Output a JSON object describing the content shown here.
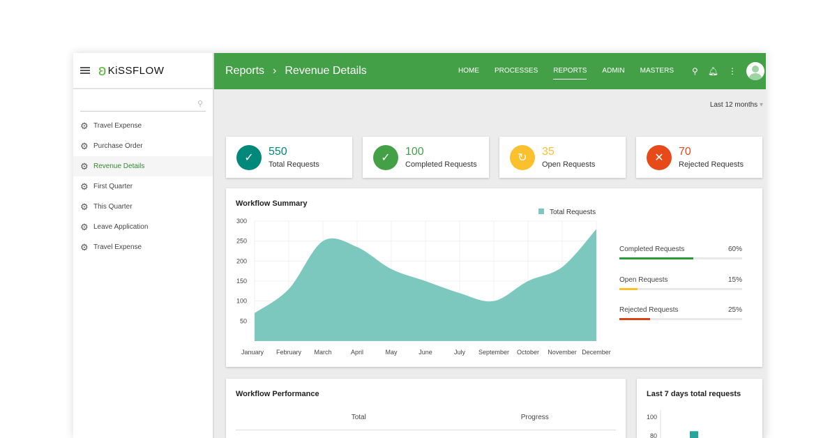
{
  "sidebar": {
    "brand": "KiSSFLOW",
    "items": [
      {
        "label": "Travel Expense"
      },
      {
        "label": "Purchase Order"
      },
      {
        "label": "Revenue Details",
        "active": true
      },
      {
        "label": "First Quarter"
      },
      {
        "label": "This Quarter"
      },
      {
        "label": "Leave Application"
      },
      {
        "label": "Travel Expense"
      }
    ]
  },
  "header": {
    "crumb1": "Reports",
    "sep": "›",
    "crumb2": "Revenue Details",
    "menu": [
      "HOME",
      "PROCESSES",
      "REPORTS",
      "ADMIN",
      "MASTERS"
    ],
    "active_menu": "REPORTS",
    "color": "#43a047"
  },
  "filter": {
    "range": "Last 12 months"
  },
  "stats": [
    {
      "value": "550",
      "label": "Total Requests",
      "color": "#00897b"
    },
    {
      "value": "100",
      "label": "Completed Requests",
      "color": "#43a047"
    },
    {
      "value": "35",
      "label": "Open Requests",
      "color": "#fbc02d"
    },
    {
      "value": "70",
      "label": "Rejected Requests",
      "color": "#e64a19"
    }
  ],
  "summary": {
    "title": "Workflow Summary",
    "progress": [
      {
        "label": "Completed Requests",
        "pct": "60%",
        "value": 60,
        "color": "#2e9a3a"
      },
      {
        "label": "Open Requests",
        "pct": "15%",
        "value": 15,
        "color": "#fbc02d"
      },
      {
        "label": "Rejected Requests",
        "pct": "25%",
        "value": 25,
        "color": "#d84315"
      }
    ]
  },
  "performance": {
    "title": "Workflow Performance",
    "cols": [
      "Total",
      "Progress"
    ]
  },
  "chart_data": [
    {
      "type": "area",
      "title": "Workflow Summary",
      "legend": "top-right",
      "series": [
        {
          "name": "Total Requests",
          "color": "#7cc8bf",
          "values": [
            70,
            130,
            250,
            235,
            180,
            150,
            120,
            100,
            150,
            185,
            280
          ]
        }
      ],
      "categories": [
        "January",
        "February",
        "March",
        "April",
        "May",
        "June",
        "July",
        "September",
        "October",
        "November",
        "December"
      ],
      "yticks": [
        50,
        100,
        150,
        200,
        250,
        300
      ],
      "ylim": [
        0,
        300
      ],
      "grid": true
    },
    {
      "type": "bar",
      "title": "Last 7 days total requests",
      "yticks": [
        80,
        100
      ],
      "values": [
        85
      ],
      "color": "#26a69a"
    }
  ]
}
